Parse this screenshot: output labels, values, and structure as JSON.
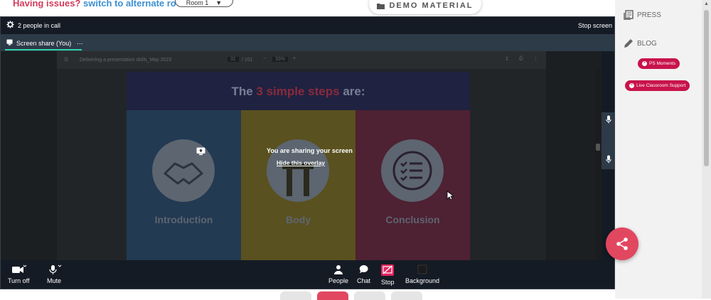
{
  "topbar": {
    "issues_text": "Having issues?",
    "alt_room_link": "switch to alternate room",
    "room_value": "Room 1",
    "demo_label": "DEMO MATERIAL"
  },
  "call": {
    "people_count": "2 people in call",
    "stop_screen": "Stop screen",
    "share_tab": "Screen share (You)",
    "share_more": "⋯"
  },
  "doc": {
    "filename": "Delivering a presentation skills_May 2023",
    "page": "31",
    "page_total": "/ 101",
    "zoom": "33%"
  },
  "slide": {
    "title_pre": "The ",
    "title_hl": "3 simple steps",
    "title_post": " are:",
    "panels": [
      "Introduction",
      "Body",
      "Conclusion"
    ]
  },
  "overlay": {
    "message": "You are sharing your screen",
    "hide_link": "Hide this overlay"
  },
  "controls": {
    "turn_off": "Turn off",
    "mute": "Mute",
    "people": "People",
    "chat": "Chat",
    "stop": "Stop",
    "background": "Background"
  },
  "sidebar": {
    "press": "PRESS",
    "blog": "BLOG",
    "ps_moments": "PS Moments",
    "live_support": "Live Classroom Support"
  },
  "colors": {
    "accent_pink": "#c8134c",
    "share_fab": "#e24760",
    "tab_underline": "#2ed3a6"
  }
}
